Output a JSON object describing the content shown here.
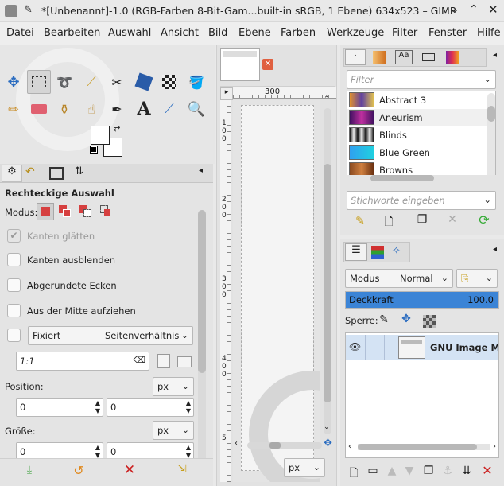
{
  "window": {
    "title": "*[Unbenannt]-1.0 (RGB-Farben 8-Bit-Gam...built-in sRGB, 1 Ebene) 634x523 – GIMP"
  },
  "menu": [
    "Datei",
    "Bearbeiten",
    "Auswahl",
    "Ansicht",
    "Bild",
    "Ebene",
    "Farben",
    "Werkzeuge",
    "Filter",
    "Fenster",
    "Hilfe"
  ],
  "tool_options": {
    "title": "Rechteckige Auswahl",
    "modus_label": "Modus:",
    "antialias_label": "Kanten glätten",
    "feather_label": "Kanten ausblenden",
    "rounded_label": "Abgerundete Ecken",
    "center_label": "Aus der Mitte aufziehen",
    "fixed_select": "Fixiert",
    "fixed_value": "Seitenverhältnis",
    "ratio_value": "1:1",
    "position_label": "Position:",
    "position_unit": "px",
    "position_x": "0",
    "position_y": "0",
    "size_label": "Größe:",
    "size_unit": "px",
    "size_w": "0",
    "size_h": "0"
  },
  "canvas": {
    "ruler_top_label": "300",
    "ruler_left_labels": [
      "1",
      "0",
      "0",
      "2",
      "0",
      "0",
      "3",
      "0",
      "0",
      "4",
      "0",
      "0",
      "5"
    ],
    "unit": "px"
  },
  "gradients": {
    "filter_placeholder": "Filter",
    "tags_placeholder": "Stichworte eingeben",
    "items": [
      "Abstract 3",
      "Aneurism",
      "Blinds",
      "Blue Green",
      "Browns"
    ],
    "tab_text": "Aa"
  },
  "layers": {
    "mode_label": "Modus",
    "mode_value": "Normal",
    "opacity_label": "Deckkraft",
    "opacity_value": "100.0",
    "lock_label": "Sperre:",
    "layer_name": "GNU Image Ma"
  },
  "colors": {
    "accent": "#3b84d6",
    "delete": "#cc2222",
    "refresh": "#33aa33"
  }
}
